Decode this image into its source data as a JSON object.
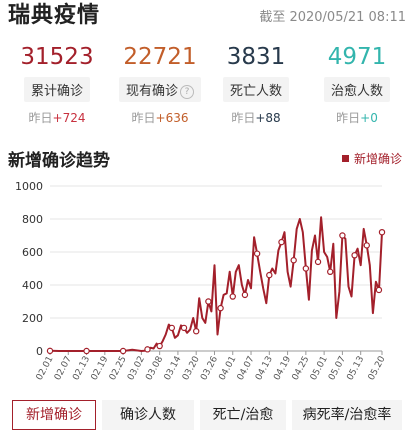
{
  "header": {
    "title": "瑞典疫情",
    "as_of": "截至 2020/05/21 08:11"
  },
  "stats": [
    {
      "value": "31523",
      "label": "累计确诊",
      "delta_prefix": "昨日",
      "delta": "+724",
      "color": "#a3202b",
      "delta_color": "#c8313f",
      "help": false
    },
    {
      "value": "22721",
      "label": "现有确诊",
      "delta_prefix": "昨日",
      "delta": "+636",
      "color": "#c25e2a",
      "delta_color": "#c25e2a",
      "help": true
    },
    {
      "value": "3831",
      "label": "死亡人数",
      "delta_prefix": "昨日",
      "delta": "+88",
      "color": "#283a4c",
      "delta_color": "#283a4c",
      "help": false
    },
    {
      "value": "4971",
      "label": "治愈人数",
      "delta_prefix": "昨日",
      "delta": "+0",
      "color": "#33b5ad",
      "delta_color": "#33b5ad",
      "help": false
    }
  ],
  "section_title": "新增确诊趋势",
  "legend_label": "新增确诊",
  "chart_data": {
    "type": "line",
    "series": [
      {
        "name": "新增确诊",
        "color": "#a3202b"
      }
    ],
    "ylim": [
      0,
      1000
    ],
    "yticks": [
      0,
      200,
      400,
      600,
      800,
      1000
    ],
    "xticks": [
      "02.01",
      "02.07",
      "02.13",
      "02.19",
      "02.25",
      "03.02",
      "03.08",
      "03.14",
      "03.20",
      "03.26",
      "04.01",
      "04.07",
      "04.13",
      "04.19",
      "04.25",
      "05.01",
      "05.07",
      "05.13",
      "05.20"
    ],
    "x": [
      "02.01",
      "02.04",
      "02.07",
      "02.10",
      "02.13",
      "02.16",
      "02.19",
      "02.22",
      "02.25",
      "02.28",
      "03.02",
      "03.03",
      "03.04",
      "03.05",
      "03.06",
      "03.07",
      "03.08",
      "03.09",
      "03.10",
      "03.11",
      "03.12",
      "03.13",
      "03.14",
      "03.15",
      "03.16",
      "03.17",
      "03.18",
      "03.19",
      "03.20",
      "03.21",
      "03.22",
      "03.23",
      "03.24",
      "03.25",
      "03.26",
      "03.27",
      "03.28",
      "03.29",
      "03.30",
      "03.31",
      "04.01",
      "04.02",
      "04.03",
      "04.04",
      "04.05",
      "04.06",
      "04.07",
      "04.08",
      "04.09",
      "04.10",
      "04.11",
      "04.12",
      "04.13",
      "04.14",
      "04.15",
      "04.16",
      "04.17",
      "04.18",
      "04.19",
      "04.20",
      "04.21",
      "04.22",
      "04.23",
      "04.24",
      "04.25",
      "04.26",
      "04.27",
      "04.28",
      "04.29",
      "04.30",
      "05.01",
      "05.02",
      "05.03",
      "05.04",
      "05.05",
      "05.06",
      "05.07",
      "05.08",
      "05.09",
      "05.10",
      "05.11",
      "05.12",
      "05.13",
      "05.14",
      "05.15",
      "05.16",
      "05.17",
      "05.18",
      "05.19",
      "05.20"
    ],
    "values": [
      1,
      0,
      0,
      0,
      0,
      0,
      0,
      0,
      0,
      7,
      0,
      1,
      10,
      20,
      15,
      45,
      30,
      60,
      100,
      160,
      140,
      80,
      95,
      155,
      140,
      110,
      130,
      200,
      120,
      320,
      200,
      170,
      300,
      240,
      520,
      100,
      260,
      340,
      350,
      480,
      330,
      480,
      520,
      400,
      340,
      430,
      380,
      690,
      590,
      480,
      380,
      290,
      460,
      500,
      470,
      610,
      660,
      720,
      480,
      390,
      550,
      740,
      800,
      720,
      500,
      310,
      610,
      700,
      540,
      810,
      600,
      570,
      480,
      650,
      200,
      360,
      700,
      680,
      390,
      330,
      580,
      620,
      520,
      740,
      640,
      520,
      230,
      420,
      370,
      720
    ],
    "markers_every": 4
  },
  "tabs": [
    {
      "label": "新增确诊",
      "active": true
    },
    {
      "label": "确诊人数",
      "active": false
    },
    {
      "label": "死亡/治愈",
      "active": false
    },
    {
      "label": "病死率/治愈率",
      "active": false
    }
  ]
}
